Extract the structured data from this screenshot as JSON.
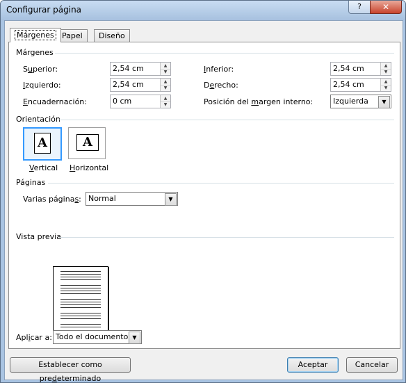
{
  "window": {
    "title": "Configurar página",
    "help": "?",
    "close": "✕"
  },
  "tabs": [
    "Márgenes",
    "Papel",
    "Diseño"
  ],
  "margins": {
    "heading": "Márgenes",
    "superior": {
      "label_pre": "S",
      "label_u": "u",
      "label_post": "perior:",
      "value": "2,54 cm"
    },
    "izquierdo": {
      "label_pre": "",
      "label_u": "I",
      "label_post": "zquierdo:",
      "value": "2,54 cm"
    },
    "encuadernacion": {
      "label_pre": "",
      "label_u": "E",
      "label_post": "ncuadernación:",
      "value": "0 cm"
    },
    "inferior": {
      "label_pre": "",
      "label_u": "I",
      "label_post": "nferior:",
      "value": "2,54 cm"
    },
    "derecho": {
      "label_pre": "D",
      "label_u": "e",
      "label_post": "recho:",
      "value": "2,54 cm"
    },
    "posicion": {
      "label_pre": "Posición del ",
      "label_u": "m",
      "label_post": "argen interno:",
      "value": "Izquierda"
    }
  },
  "orientation": {
    "heading": "Orientación",
    "vertical": {
      "label_u": "V",
      "label_post": "ertical",
      "glyph": "A"
    },
    "horizontal": {
      "label_u": "H",
      "label_post": "orizontal",
      "glyph": "A"
    }
  },
  "pages": {
    "heading": "Páginas",
    "label_pre": "Varias página",
    "label_u": "s",
    "label_post": ":",
    "value": "Normal"
  },
  "preview": {
    "heading": "Vista previa"
  },
  "apply": {
    "label_pre": "Apl",
    "label_u": "i",
    "label_post": "car a:",
    "value": "Todo el documento"
  },
  "buttons": {
    "default_pre": "Establecer como pre",
    "default_u": "d",
    "default_post": "eterminado",
    "ok": "Aceptar",
    "cancel": "Cancelar"
  }
}
